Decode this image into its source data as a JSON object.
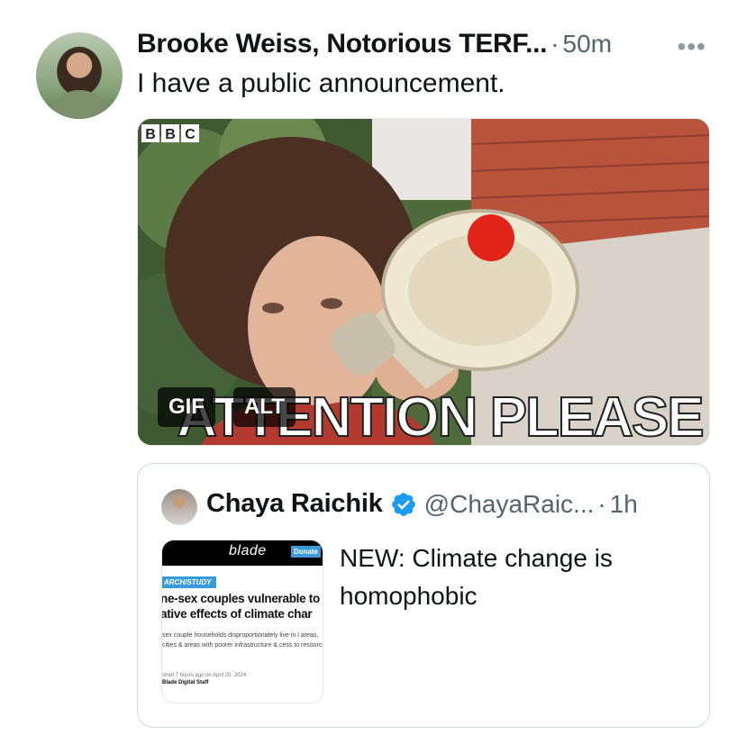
{
  "tweet": {
    "author_name": "Brooke Weiss, Notorious TERF...",
    "separator": "·",
    "time": "50m",
    "more_glyph": "•••",
    "text": "I have a public announcement.",
    "media": {
      "overlay_brand": "BBC",
      "overlay_caption": "ATTENTION PLEASE",
      "gif_badge": "GIF",
      "alt_badge": "ALT"
    }
  },
  "quote": {
    "author_name": "Chaya Raichik",
    "handle": "@ChayaRaic...",
    "separator": "·",
    "time": "1h",
    "text": "NEW: Climate change is homophobic",
    "thumbnail": {
      "logo": "blade",
      "donate": "Donate",
      "category": "ARCH/STUDY",
      "headline": "ne-sex couples vulnerable to ative effects of climate char",
      "subhead": "sex couple households disproportionately live in l areas, cities & areas with poorer infrastructure & cess to resources",
      "byline_date": "shed 7 hours ago on April 20, 2024",
      "byline_author": "Blade Digital Staff"
    }
  },
  "colors": {
    "text_primary": "#0f1419",
    "text_secondary": "#536471",
    "verified_blue": "#1d9bf0",
    "border": "#cfd9de"
  },
  "icons": [
    "more-icon",
    "verified-badge-icon"
  ]
}
